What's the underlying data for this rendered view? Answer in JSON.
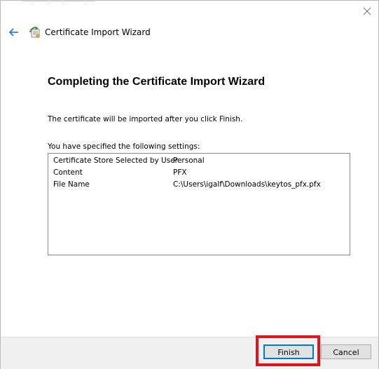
{
  "window": {
    "title": "Certificate Import Wizard"
  },
  "heading": "Completing the Certificate Import Wizard",
  "intro_text": "The certificate will be imported after you click Finish.",
  "settings": {
    "label": "You have specified the following settings:",
    "rows": [
      {
        "key": "Certificate Store Selected by User",
        "value": "Personal"
      },
      {
        "key": "Content",
        "value": "PFX"
      },
      {
        "key": "File Name",
        "value": "C:\\Users\\igalf\\Downloads\\keytos_pfx.pfx"
      }
    ]
  },
  "buttons": {
    "finish": "Finish",
    "cancel": "Cancel"
  },
  "icons": {
    "back": "back-arrow-icon",
    "close": "close-icon",
    "wizard": "certificate-wizard-icon"
  },
  "colors": {
    "accent": "#0078d7",
    "highlight": "#e0141c",
    "footer_bg": "#f0f0f0"
  }
}
